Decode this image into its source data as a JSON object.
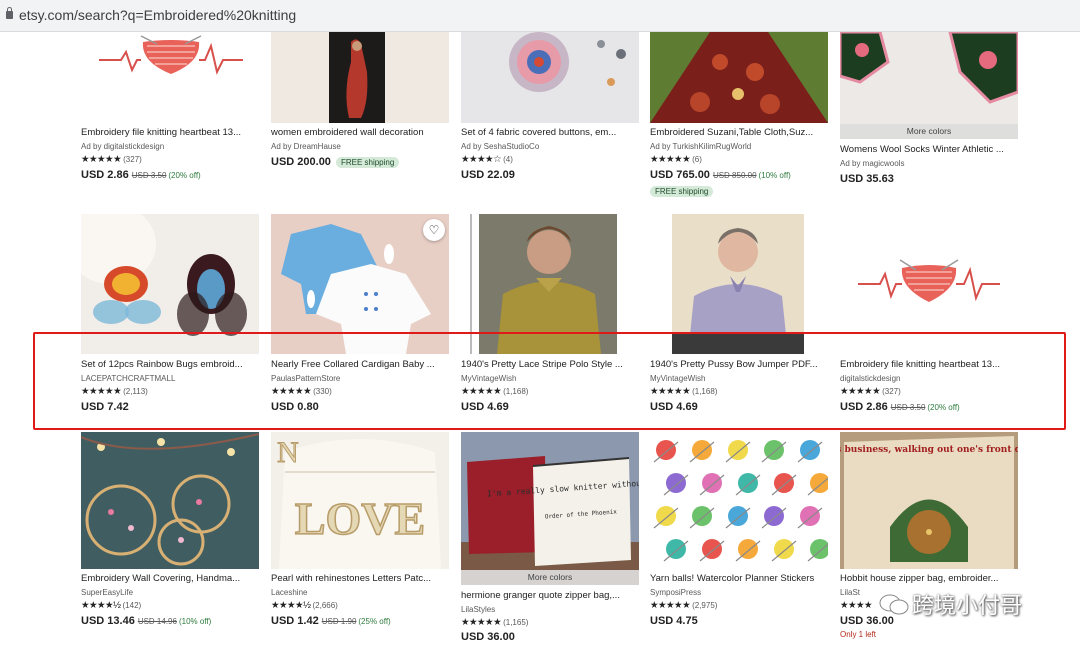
{
  "browser": {
    "url": "etsy.com/search?q=Embroidered%20knitting"
  },
  "rows": [
    [
      {
        "title": "Embroidery file knitting heartbeat 13...",
        "shop": "Ad by digitalstickdesign",
        "stars": "★★★★★",
        "reviews": "(327)",
        "price": "USD 2.86",
        "orig": "USD 3.50",
        "off": "(20% off)"
      },
      {
        "title": "women embroidered wall decoration",
        "shop": "Ad by DreamHause",
        "price": "USD 200.00",
        "badge": "FREE shipping"
      },
      {
        "title": "Set of 4 fabric covered buttons, em...",
        "shop": "Ad by SeshaStudioCo",
        "stars": "★★★★☆",
        "reviews": "(4)",
        "price": "USD 22.09"
      },
      {
        "title": "Embroidered Suzani,Table Cloth,Suz...",
        "shop": "Ad by TurkishKilimRugWorld",
        "stars": "★★★★★",
        "reviews": "(6)",
        "price": "USD 765.00",
        "orig": "USD 850.00",
        "off": "(10% off)",
        "badge_line": "FREE shipping"
      },
      {
        "title": "Womens Wool Socks Winter Athletic ...",
        "shop": "Ad by magicwools",
        "price": "USD 35.63",
        "more": "More colors"
      }
    ],
    [
      {
        "title": "Set of 12pcs Rainbow Bugs embroid...",
        "shop": "LACEPATCHCRAFTMALL",
        "stars": "★★★★★",
        "reviews": "(2,113)",
        "price": "USD 7.42"
      },
      {
        "title": "Nearly Free Collared Cardigan Baby ...",
        "shop": "PaulasPatternStore",
        "stars": "★★★★★",
        "reviews": "(330)",
        "price": "USD 0.80"
      },
      {
        "title": "1940's Pretty Lace Stripe Polo Style ...",
        "shop": "MyVintageWish",
        "stars": "★★★★★",
        "reviews": "(1,168)",
        "price": "USD 4.69"
      },
      {
        "title": "1940's Pretty Pussy Bow Jumper PDF...",
        "shop": "MyVintageWish",
        "stars": "★★★★★",
        "reviews": "(1,168)",
        "price": "USD 4.69"
      },
      {
        "title": "Embroidery file knitting heartbeat 13...",
        "shop": "digitalstickdesign",
        "stars": "★★★★★",
        "reviews": "(327)",
        "price": "USD 2.86",
        "orig": "USD 3.50",
        "off": "(20% off)"
      }
    ],
    [
      {
        "title": "Embroidery Wall Covering, Handma...",
        "shop": "SuperEasyLife",
        "stars": "★★★★½",
        "reviews": "(142)",
        "price": "USD 13.46",
        "orig": "USD 14.96",
        "off": "(10% off)"
      },
      {
        "title": "Pearl with rehinestones Letters Patc...",
        "shop": "Laceshine",
        "stars": "★★★★½",
        "reviews": "(2,666)",
        "price": "USD 1.42",
        "orig": "USD 1.90",
        "off": "(25% off)"
      },
      {
        "title": "hermione granger quote zipper bag,...",
        "shop": "LilaStyles",
        "stars": "★★★★★",
        "reviews": "(1,165)",
        "price": "USD 36.00",
        "more": "More colors"
      },
      {
        "title": "Yarn balls! Watercolor Planner Stickers",
        "shop": "SymposiPress",
        "stars": "★★★★★",
        "reviews": "(2,975)",
        "price": "USD 4.75"
      },
      {
        "title": "Hobbit house zipper bag, embroider...",
        "shop": "LilaSt",
        "stars": "★★★★",
        "reviews": "",
        "price": "USD 36.00",
        "extra": "Only 1 left"
      }
    ]
  ],
  "image_text": {
    "bag1_text": "I'm a really slow knitter without magic",
    "bag2_text": "It's a dangerous business, walking out one's front door.",
    "bag1_sub": "Order of the Phoenix",
    "love_text": "LOVE"
  },
  "watermark": {
    "text": "跨境小付哥"
  },
  "colors": {
    "highlight": "#e01919",
    "free_bg": "#d4e9d7",
    "discount": "#2f7d3f"
  }
}
